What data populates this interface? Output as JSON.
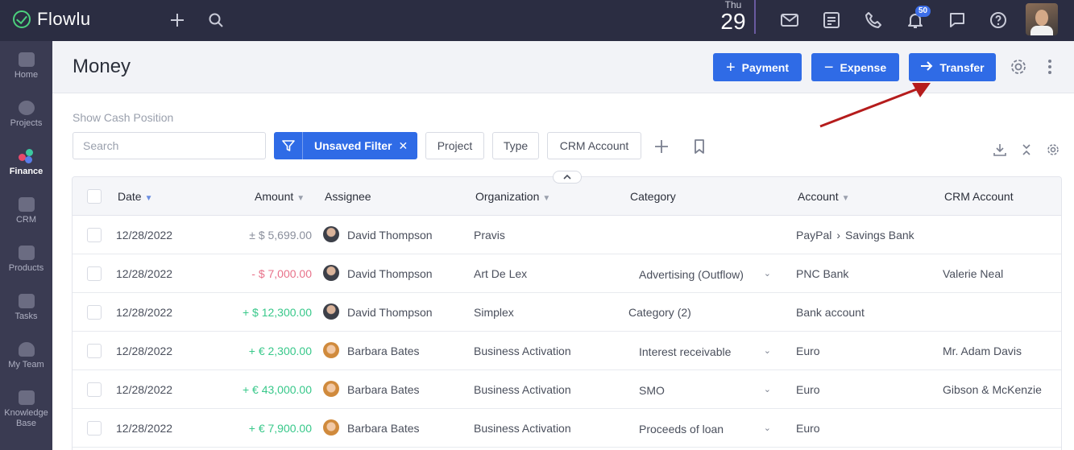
{
  "app": {
    "name": "Flowlu"
  },
  "topbar": {
    "date_day": "Thu",
    "date_num": "29",
    "notifications_count": "50",
    "icons": [
      "plus-icon",
      "search-icon",
      "mail-icon",
      "notes-icon",
      "phone-icon",
      "bell-icon",
      "chat-icon",
      "help-icon"
    ]
  },
  "sidebar": {
    "items": [
      {
        "label": "Home",
        "icon": "home-icon",
        "active": false
      },
      {
        "label": "Projects",
        "icon": "projects-icon",
        "active": false
      },
      {
        "label": "Finance",
        "icon": "finance-icon",
        "active": true
      },
      {
        "label": "CRM",
        "icon": "crm-icon",
        "active": false
      },
      {
        "label": "Products",
        "icon": "products-icon",
        "active": false
      },
      {
        "label": "Tasks",
        "icon": "tasks-icon",
        "active": false
      },
      {
        "label": "My Team",
        "icon": "team-icon",
        "active": false
      },
      {
        "label": "Knowledge",
        "label2": "Base",
        "icon": "knowledge-icon",
        "active": false
      }
    ]
  },
  "header": {
    "title": "Money",
    "payment_label": "Payment",
    "expense_label": "Expense",
    "transfer_label": "Transfer"
  },
  "toolbar": {
    "show_cash": "Show Cash Position",
    "search_placeholder": "Search",
    "filter_label": "Unsaved Filter",
    "chips": [
      "Project",
      "Type",
      "CRM Account"
    ]
  },
  "table": {
    "columns": [
      "Date",
      "Amount",
      "Assignee",
      "Organization",
      "Category",
      "Account",
      "CRM Account"
    ],
    "rows": [
      {
        "date": "12/28/2022",
        "amount": "± $ 5,699.00",
        "amount_type": "neutral",
        "assignee": "David Thompson",
        "avatar": "david",
        "organization": "Pravis",
        "category": "",
        "category_select": false,
        "account": "PayPal",
        "account2": "Savings Bank",
        "crm": ""
      },
      {
        "date": "12/28/2022",
        "amount": "- $ 7,000.00",
        "amount_type": "neg",
        "assignee": "David Thompson",
        "avatar": "david",
        "organization": "Art De Lex",
        "category": "Advertising (Outflow)",
        "category_select": true,
        "account": "PNC Bank",
        "account2": "",
        "crm": "Valerie Neal"
      },
      {
        "date": "12/28/2022",
        "amount": "+ $ 12,300.00",
        "amount_type": "pos",
        "assignee": "David Thompson",
        "avatar": "david",
        "organization": "Simplex",
        "category": "Category (2)",
        "category_select": false,
        "account": "Bank account",
        "account2": "",
        "crm": ""
      },
      {
        "date": "12/28/2022",
        "amount": "+ € 2,300.00",
        "amount_type": "pos",
        "assignee": "Barbara Bates",
        "avatar": "barbara",
        "organization": "Business Activation",
        "category": "Interest receivable",
        "category_select": true,
        "account": "Euro",
        "account2": "",
        "crm": "Mr. Adam Davis"
      },
      {
        "date": "12/28/2022",
        "amount": "+ € 43,000.00",
        "amount_type": "pos",
        "assignee": "Barbara Bates",
        "avatar": "barbara",
        "organization": "Business Activation",
        "category": "SMO",
        "category_select": true,
        "account": "Euro",
        "account2": "",
        "crm": "Gibson & McKenzie"
      },
      {
        "date": "12/28/2022",
        "amount": "+ € 7,900.00",
        "amount_type": "pos",
        "assignee": "Barbara Bates",
        "avatar": "barbara",
        "organization": "Business Activation",
        "category": "Proceeds of loan",
        "category_select": true,
        "account": "Euro",
        "account2": "",
        "crm": ""
      }
    ]
  },
  "colors": {
    "accent": "#2f6be6",
    "topbar_bg": "#2b2d42",
    "sidebar_bg": "#3a3b52",
    "positive": "#38c88a",
    "negative": "#e8728a",
    "annotation_arrow": "#b51c1c"
  }
}
